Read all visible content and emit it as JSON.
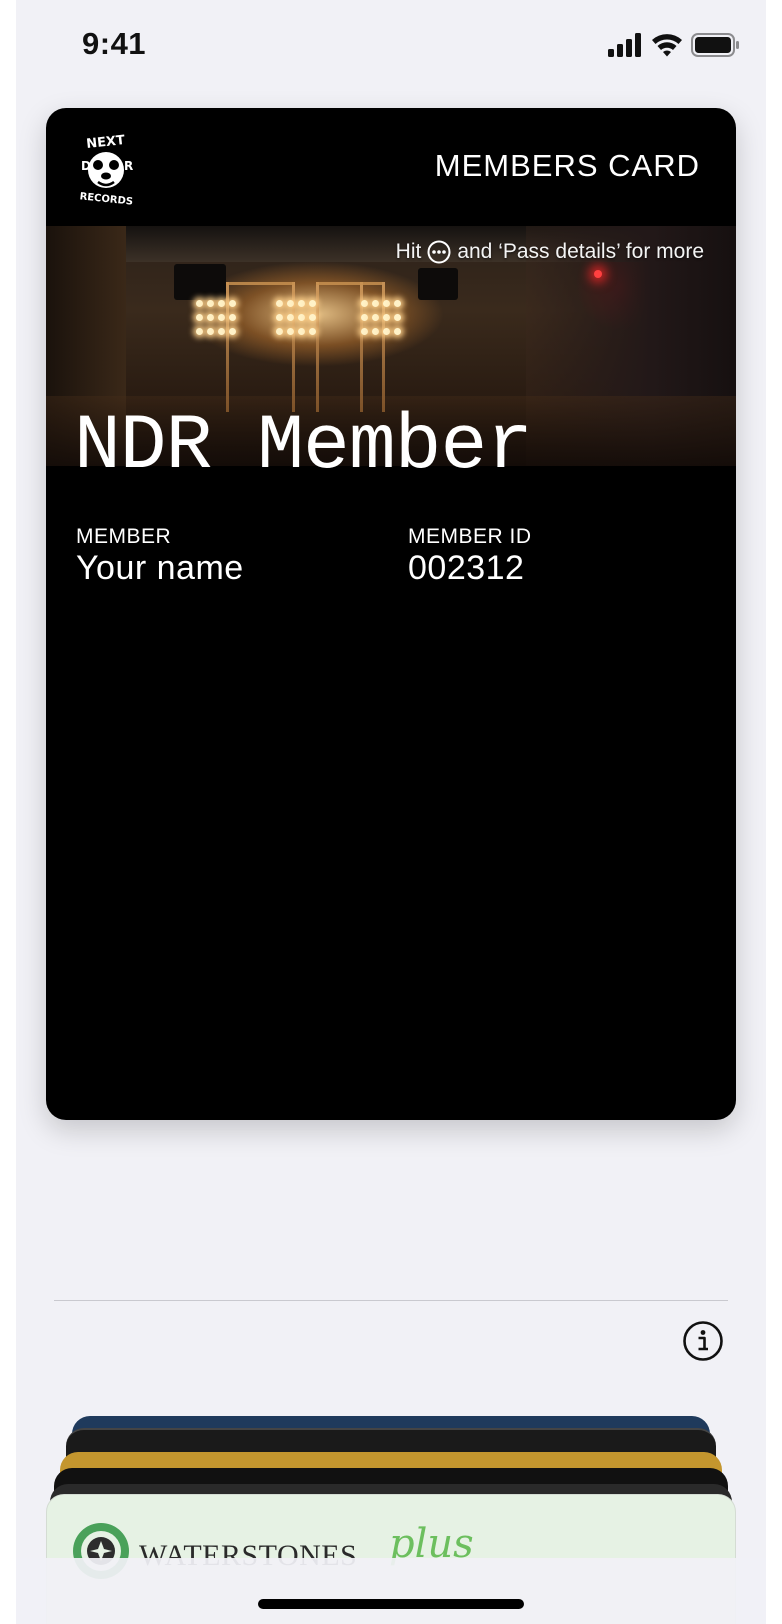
{
  "status_bar": {
    "time": "9:41"
  },
  "pass": {
    "logo_text": "NEXT DOOR RECORDS",
    "card_type": "MEMBERS CARD",
    "hint_before": "Hit",
    "hint_after": "and ‘Pass details’ for more",
    "primary": "NDR Member",
    "fields": [
      {
        "label": "MEMBER",
        "value": "Your name"
      },
      {
        "label": "MEMBER ID",
        "value": "002312"
      }
    ],
    "background_color": "#000000"
  },
  "stack": {
    "card_colors": [
      "#1f3a5c",
      "#1a1a1a",
      "#c4962e",
      "#111111",
      "#2a2a2a"
    ],
    "waterstones": {
      "name": "WATERSTONES",
      "plus": "plus",
      "accent": "#6cbf5e"
    }
  },
  "icons": {
    "more": "ellipsis-circle-icon",
    "info": "info-circle-icon"
  }
}
